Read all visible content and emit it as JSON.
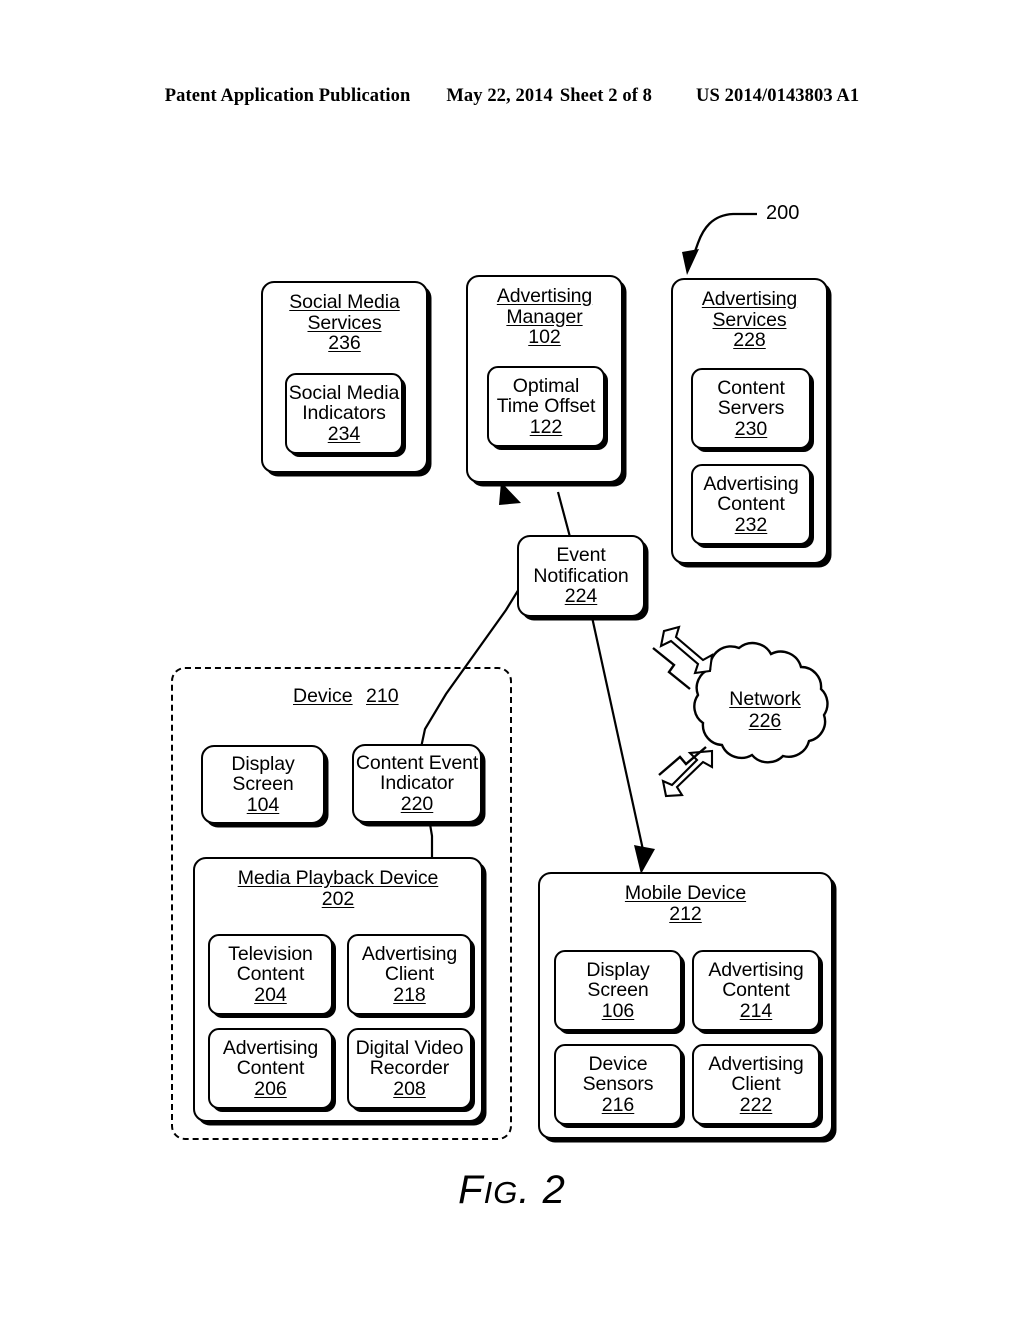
{
  "header": {
    "publication": "Patent Application Publication",
    "date": "May 22, 2014",
    "sheet": "Sheet 2 of 8",
    "patent_number": "US 2014/0143803 A1"
  },
  "figure": {
    "caption_prefix": "F",
    "caption_mid": "IG",
    "caption_suffix": ". 2",
    "diagram_label": "200"
  },
  "nodes": {
    "social_media_services": {
      "title_line1": "Social Media",
      "title_line2": "Services",
      "number": "236"
    },
    "social_media_indicators": {
      "title_line1": "Social Media",
      "title_line2": "Indicators",
      "number": "234"
    },
    "advertising_manager": {
      "title_line1": "Advertising",
      "title_line2": "Manager",
      "number": "102"
    },
    "optimal_time_offset": {
      "title_line1": "Optimal",
      "title_line2": "Time Offset",
      "number": "122"
    },
    "advertising_services": {
      "title_line1": "Advertising",
      "title_line2": "Services",
      "number": "228"
    },
    "content_servers": {
      "title_line1": "Content",
      "title_line2": "Servers",
      "number": "230"
    },
    "advertising_content_232": {
      "title_line1": "Advertising",
      "title_line2": "Content",
      "number": "232"
    },
    "event_notification": {
      "title_line1": "Event",
      "title_line2": "Notification",
      "number": "224"
    },
    "network": {
      "title_line1": "Network",
      "number": "226"
    },
    "device": {
      "title_line1": "Device",
      "number": "210"
    },
    "display_screen_104": {
      "title_line1": "Display",
      "title_line2": "Screen",
      "number": "104"
    },
    "content_event_indicator": {
      "title_line1": "Content Event",
      "title_line2": "Indicator",
      "number": "220"
    },
    "media_playback_device": {
      "title_line1": "Media Playback Device",
      "number": "202"
    },
    "television_content": {
      "title_line1": "Television",
      "title_line2": "Content",
      "number": "204"
    },
    "advertising_client_218": {
      "title_line1": "Advertising",
      "title_line2": "Client",
      "number": "218"
    },
    "advertising_content_206": {
      "title_line1": "Advertising",
      "title_line2": "Content",
      "number": "206"
    },
    "digital_video_recorder": {
      "title_line1": "Digital Video",
      "title_line2": "Recorder",
      "number": "208"
    },
    "mobile_device": {
      "title_line1": "Mobile Device",
      "number": "212"
    },
    "display_screen_106": {
      "title_line1": "Display",
      "title_line2": "Screen",
      "number": "106"
    },
    "advertising_content_214": {
      "title_line1": "Advertising",
      "title_line2": "Content",
      "number": "214"
    },
    "device_sensors": {
      "title_line1": "Device",
      "title_line2": "Sensors",
      "number": "216"
    },
    "advertising_client_222": {
      "title_line1": "Advertising",
      "title_line2": "Client",
      "number": "222"
    }
  },
  "colors": {
    "ink": "#000000",
    "paper": "#ffffff"
  }
}
